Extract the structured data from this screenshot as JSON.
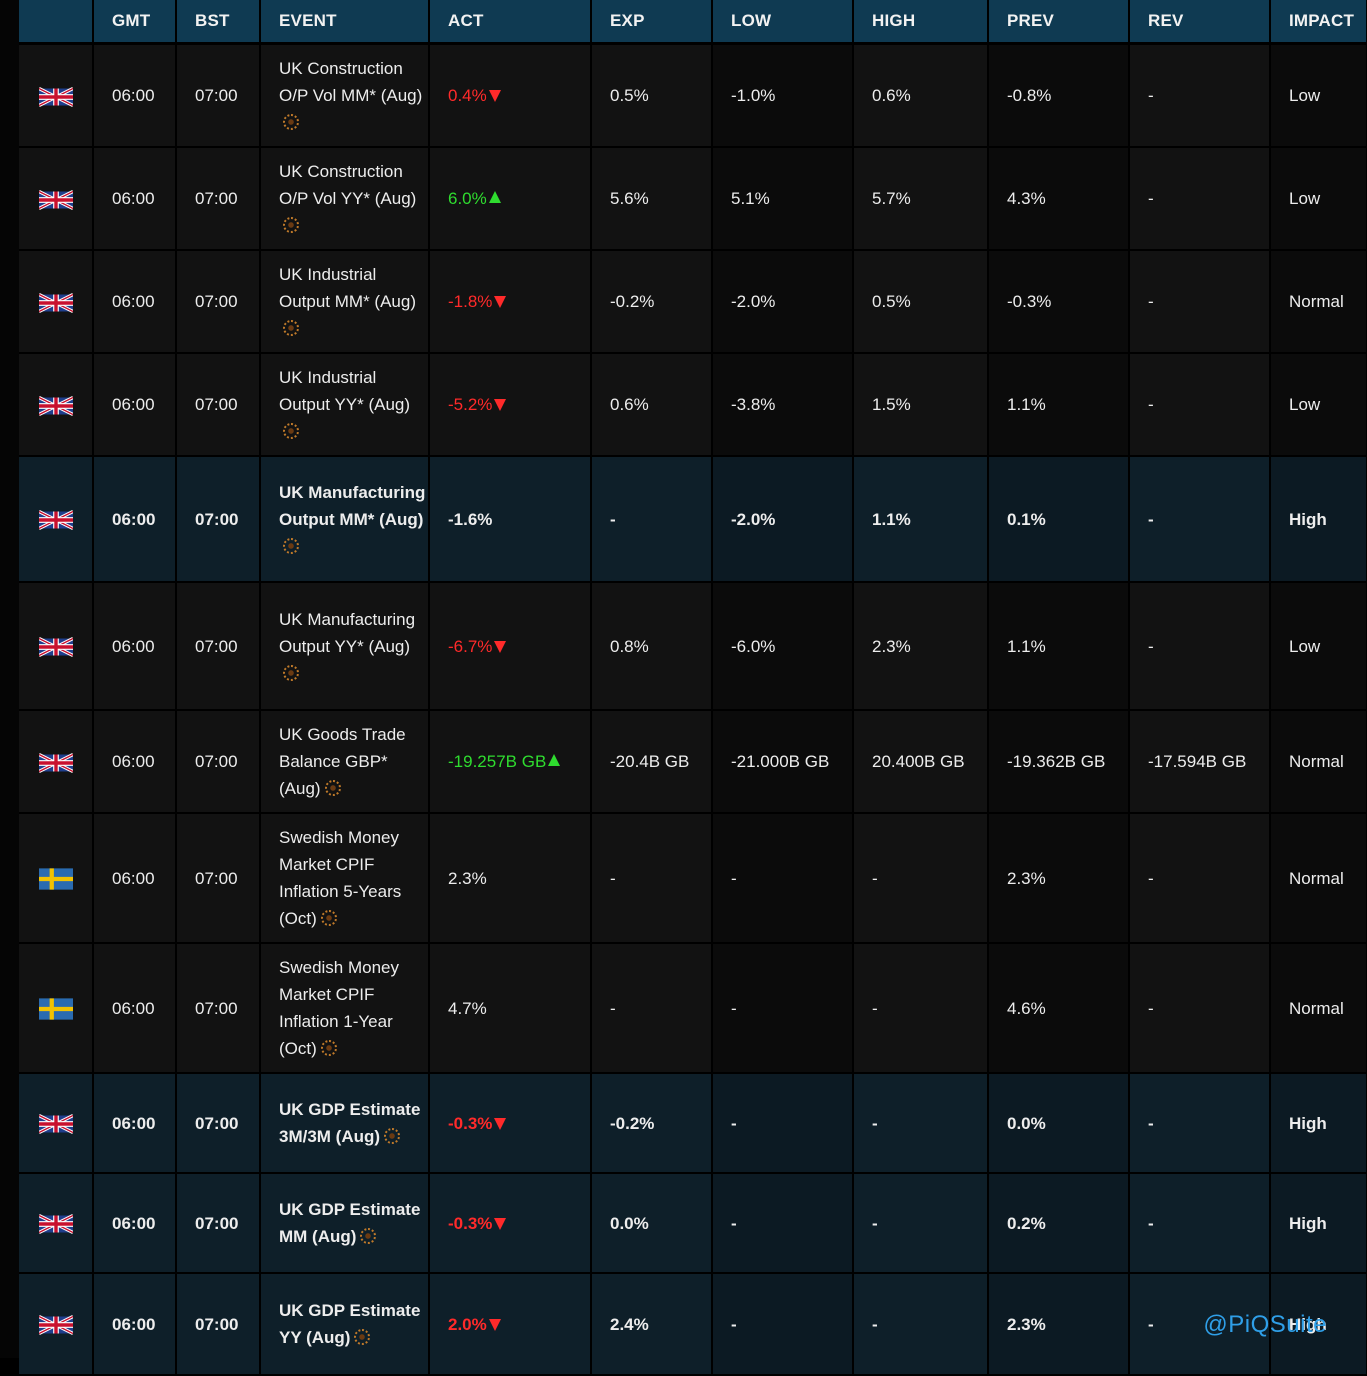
{
  "headers": {
    "gmt": "GMT",
    "bst": "BST",
    "event": "EVENT",
    "act": "ACT",
    "exp": "EXP",
    "low": "LOW",
    "high": "HIGH",
    "prev": "PREV",
    "rev": "REV",
    "impact": "IMPACT"
  },
  "rows": [
    {
      "flag": "uk-flag-icon",
      "gmt": "06:00",
      "bst": "07:00",
      "event": "UK Construction O/P Vol MM* (Aug)",
      "act": "0.4%",
      "act_trend": "down",
      "exp": "0.5%",
      "low": "-1.0%",
      "high": "0.6%",
      "prev": "-0.8%",
      "rev": "-",
      "rev_color": "red",
      "impact": "Low",
      "emphasis": false
    },
    {
      "flag": "uk-flag-icon",
      "gmt": "06:00",
      "bst": "07:00",
      "event": "UK Construction O/P Vol YY* (Aug)",
      "act": "6.0%",
      "act_trend": "up",
      "exp": "5.6%",
      "low": "5.1%",
      "high": "5.7%",
      "prev": "4.3%",
      "rev": "-",
      "rev_color": "green",
      "impact": "Low",
      "emphasis": false
    },
    {
      "flag": "uk-flag-icon",
      "gmt": "06:00",
      "bst": "07:00",
      "event": "UK Industrial Output MM* (Aug)",
      "act": "-1.8%",
      "act_trend": "down",
      "exp": "-0.2%",
      "low": "-2.0%",
      "high": "0.5%",
      "prev": "-0.3%",
      "rev": "-",
      "rev_color": "red",
      "impact": "Normal",
      "emphasis": false
    },
    {
      "flag": "uk-flag-icon",
      "gmt": "06:00",
      "bst": "07:00",
      "event": "UK Industrial Output YY* (Aug)",
      "act": "-5.2%",
      "act_trend": "down",
      "exp": "0.6%",
      "low": "-3.8%",
      "high": "1.5%",
      "prev": "1.1%",
      "rev": "-",
      "rev_color": "red",
      "impact": "Low",
      "emphasis": false
    },
    {
      "flag": "uk-flag-icon",
      "gmt": "06:00",
      "bst": "07:00",
      "event": "UK Manufacturing Output MM* (Aug)",
      "act": "-1.6%",
      "act_trend": "none",
      "exp": "-",
      "low": "-2.0%",
      "high": "1.1%",
      "prev": "0.1%",
      "rev": "-",
      "rev_color": "white",
      "impact": "High",
      "emphasis": true
    },
    {
      "flag": "uk-flag-icon",
      "gmt": "06:00",
      "bst": "07:00",
      "event": "UK Manufacturing Output YY* (Aug)",
      "act": "-6.7%",
      "act_trend": "down",
      "exp": "0.8%",
      "low": "-6.0%",
      "high": "2.3%",
      "prev": "1.1%",
      "rev": "-",
      "rev_color": "red",
      "impact": "Low",
      "emphasis": false
    },
    {
      "flag": "uk-flag-icon",
      "gmt": "06:00",
      "bst": "07:00",
      "event": "UK Goods Trade Balance GBP* (Aug)",
      "act": "-19.257B GB",
      "act_trend": "up",
      "exp": "-20.4B GB",
      "low": "-21.000B GB",
      "high": "20.400B GB",
      "prev": "-19.362B GB",
      "rev": "-17.594B GB",
      "rev_color": "green",
      "impact": "Normal",
      "emphasis": false
    },
    {
      "flag": "sweden-flag-icon",
      "gmt": "06:00",
      "bst": "07:00",
      "event": "Swedish Money Market CPIF Inflation 5-Years (Oct)",
      "act": "2.3%",
      "act_trend": "none",
      "exp": "-",
      "low": "-",
      "high": "-",
      "prev": "2.3%",
      "rev": "-",
      "rev_color": "white",
      "impact": "Normal",
      "emphasis": false
    },
    {
      "flag": "sweden-flag-icon",
      "gmt": "06:00",
      "bst": "07:00",
      "event": "Swedish Money Market CPIF Inflation 1-Year (Oct)",
      "act": "4.7%",
      "act_trend": "none",
      "exp": "-",
      "low": "-",
      "high": "-",
      "prev": "4.6%",
      "rev": "-",
      "rev_color": "white",
      "impact": "Normal",
      "emphasis": false
    },
    {
      "flag": "uk-flag-icon",
      "gmt": "06:00",
      "bst": "07:00",
      "event": "UK GDP Estimate 3M/3M (Aug)",
      "act": "-0.3%",
      "act_trend": "down",
      "exp": "-0.2%",
      "low": "-",
      "high": "-",
      "prev": "0.0%",
      "rev": "-",
      "rev_color": "red",
      "impact": "High",
      "emphasis": true
    },
    {
      "flag": "uk-flag-icon",
      "gmt": "06:00",
      "bst": "07:00",
      "event": "UK GDP Estimate MM (Aug)",
      "act": "-0.3%",
      "act_trend": "down",
      "exp": "0.0%",
      "low": "-",
      "high": "-",
      "prev": "0.2%",
      "rev": "-",
      "rev_color": "red",
      "impact": "High",
      "emphasis": true
    },
    {
      "flag": "uk-flag-icon",
      "gmt": "06:00",
      "bst": "07:00",
      "event": "UK GDP Estimate YY (Aug)",
      "act": "2.0%",
      "act_trend": "down",
      "exp": "2.4%",
      "low": "-",
      "high": "-",
      "prev": "2.3%",
      "rev": "-",
      "rev_color": "red",
      "impact": "High",
      "emphasis": true
    }
  ],
  "colors": {
    "header_bg": "#0f3a52",
    "down": "#ff2a2a",
    "up": "#2fdc2f",
    "watermark": "#2f9fe8"
  },
  "watermark": "@PiQSuite"
}
